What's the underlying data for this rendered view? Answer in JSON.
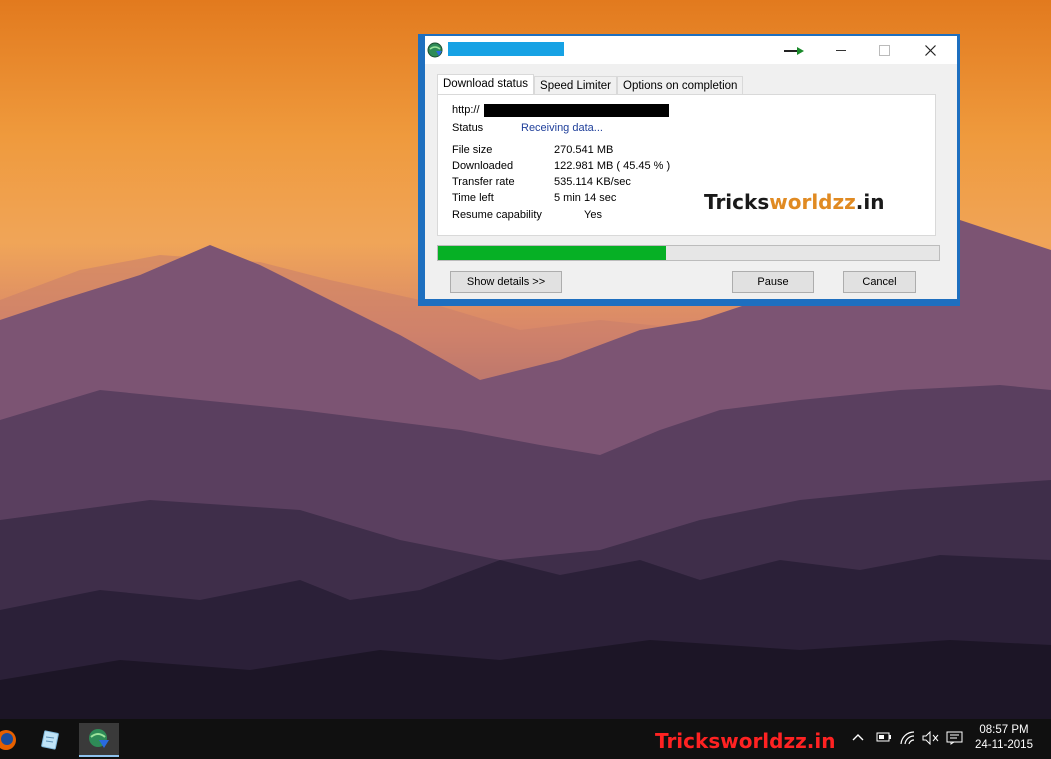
{
  "window": {
    "tabs": [
      "Download status",
      "Speed Limiter",
      "Options on completion"
    ],
    "url_prefix": "http://",
    "status_label": "Status",
    "status_value": "Receiving data...",
    "rows": [
      {
        "label": "File size",
        "value": "270.541  MB"
      },
      {
        "label": "Downloaded",
        "value": "122.981  MB  ( 45.45 % )"
      },
      {
        "label": "Transfer rate",
        "value": "535.114  KB/sec"
      },
      {
        "label": "Time left",
        "value": "5 min 14 sec"
      },
      {
        "label": "Resume capability",
        "value": "Yes"
      }
    ],
    "watermark_part1": "Tricks",
    "watermark_part2": "worldzz",
    "watermark_part3": ".in",
    "progress_percent": 45.45,
    "buttons": {
      "show_details": "Show details >>",
      "pause": "Pause",
      "cancel": "Cancel"
    }
  },
  "taskbar": {
    "watermark": "Tricksworldzz.in",
    "time": "08:57 PM",
    "date": "24-11-2015"
  },
  "colors": {
    "progress": "#06b025",
    "window_border": "#1e6fbf",
    "title_redaction": "#17a2e4",
    "status_text": "#1f3f9a",
    "watermark_accent": "#e08a22",
    "taskbar_watermark": "#ff2222"
  }
}
